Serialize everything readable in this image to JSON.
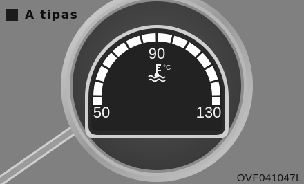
{
  "header": {
    "title": "A tipas",
    "marker_icon": "square-bullet-icon"
  },
  "gauge": {
    "name": "engine-coolant-temperature-gauge",
    "min_label": "50",
    "mid_label": "90",
    "max_label": "130",
    "unit": "°C",
    "icon": "coolant-temperature-icon",
    "segment_count": 12
  },
  "footer": {
    "code": "OVF041047L"
  },
  "colors": {
    "background": "#808080",
    "dial": "#2a2a2a",
    "ring": "#cfcfcf",
    "segments": "#ffffff"
  }
}
